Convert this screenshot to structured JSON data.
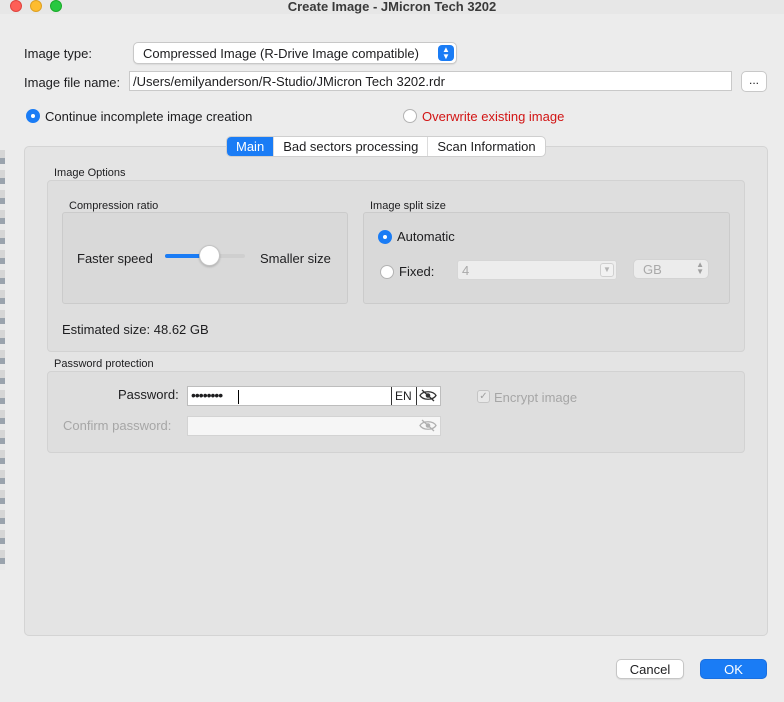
{
  "window": {
    "title": "Create Image - JMicron Tech 3202"
  },
  "image_type": {
    "label": "Image type:",
    "value": "Compressed Image (R-Drive Image compatible)"
  },
  "image_file": {
    "label": "Image file name:",
    "value": "/Users/emilyanderson/R-Studio/JMicron Tech 3202.rdr",
    "browse_label": "..."
  },
  "creation_mode": {
    "continue_label": "Continue incomplete image creation",
    "overwrite_label": "Overwrite existing image",
    "selected": "continue",
    "overwrite_color": "#d21414"
  },
  "tabs": [
    {
      "label": "Main",
      "active": true
    },
    {
      "label": "Bad sectors processing",
      "active": false
    },
    {
      "label": "Scan Information",
      "active": false
    }
  ],
  "image_options": {
    "title": "Image Options",
    "compression": {
      "title": "Compression ratio",
      "left_label": "Faster speed",
      "right_label": "Smaller size",
      "level": 0.55
    },
    "split": {
      "title": "Image split size",
      "automatic_label": "Automatic",
      "fixed_label": "Fixed:",
      "selected": "automatic",
      "fixed_value": "4",
      "unit": "GB"
    },
    "estimated_size": "Estimated size: 48.62 GB"
  },
  "password_protection": {
    "title": "Password protection",
    "password_label": "Password:",
    "password_masked": "••••••••",
    "input_language": "EN",
    "confirm_label": "Confirm password:",
    "encrypt_label": "Encrypt image",
    "encrypt_checked": true
  },
  "buttons": {
    "cancel": "Cancel",
    "ok": "OK"
  },
  "colors": {
    "accent": "#1a7cf5"
  }
}
